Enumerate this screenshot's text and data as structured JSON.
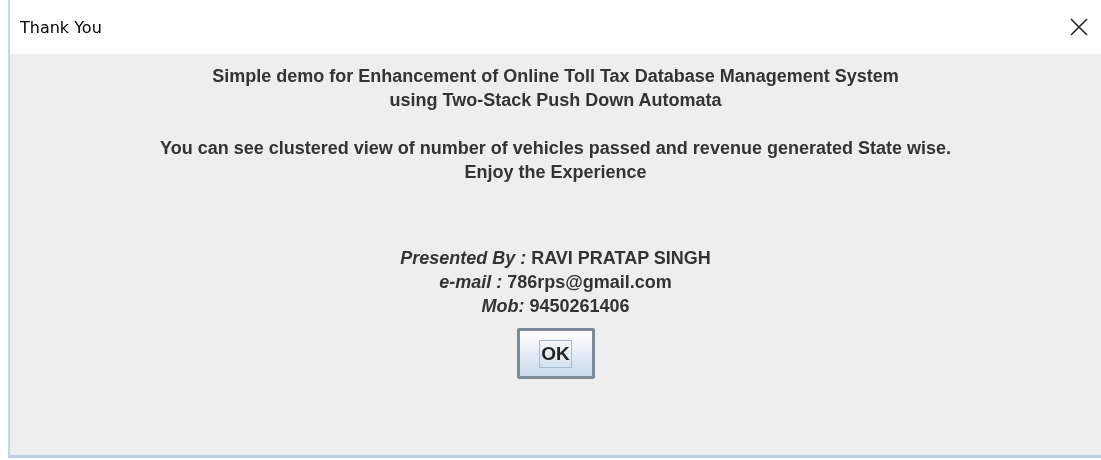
{
  "window": {
    "title": "Thank You"
  },
  "message_groups": [
    [
      "Simple demo for Enhancement of Online Toll Tax Database Management System",
      "using Two-Stack Push Down Automata"
    ],
    [
      "You can see clustered view of number of vehicles passed and revenue generated State wise.",
      "Enjoy the Experience"
    ]
  ],
  "credits": [
    {
      "text": "*Presented By :* RAVI PRATAP  SINGH"
    },
    {
      "text": "*e-mail :* 786rps@gmail.com"
    },
    {
      "text": "*Mob:* 9450261406"
    }
  ],
  "buttons": [
    "OK"
  ]
}
